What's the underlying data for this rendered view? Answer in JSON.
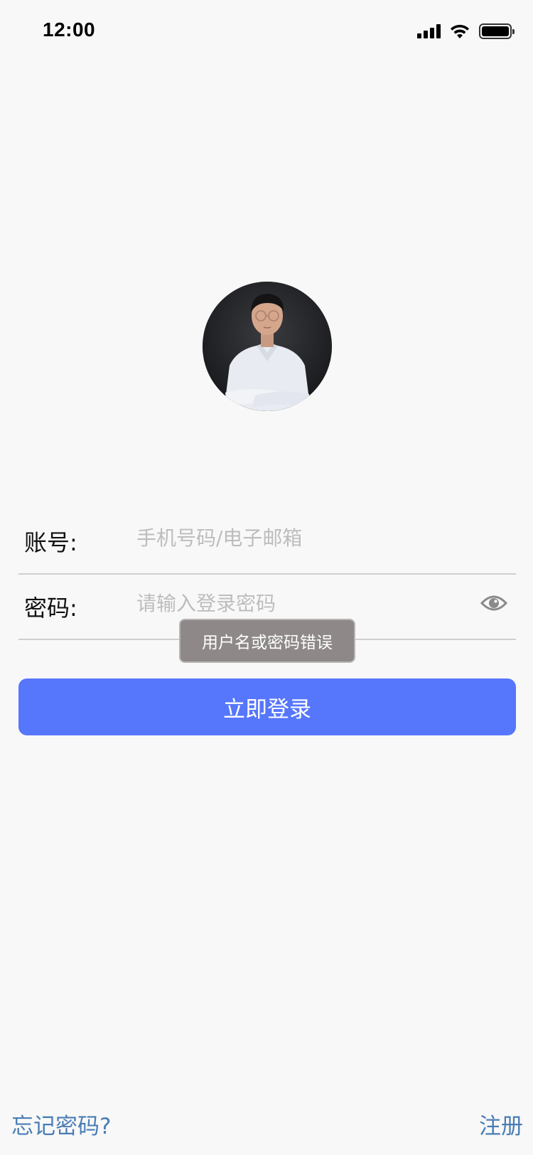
{
  "status_bar": {
    "time": "12:00",
    "icons": [
      "cellular-signal-icon",
      "wifi-icon",
      "battery-icon"
    ]
  },
  "avatar": {
    "icon": "user-avatar-photo"
  },
  "form": {
    "account": {
      "label": "账号:",
      "placeholder": "手机号码/电子邮箱",
      "value": ""
    },
    "password": {
      "label": "密码:",
      "placeholder": "请输入登录密码",
      "value": "",
      "toggle_icon": "eye-icon"
    }
  },
  "toast": {
    "message": "用户名或密码错误"
  },
  "login_button": {
    "label": "立即登录"
  },
  "links": {
    "forgot_password": "忘记密码?",
    "register": "注册"
  },
  "colors": {
    "background": "#f8f8f8",
    "primary": "#5676fc",
    "link": "#4a7db5",
    "toast_bg": "#8e8888",
    "placeholder": "#bdbdbd",
    "divider": "#cfcfcf"
  }
}
